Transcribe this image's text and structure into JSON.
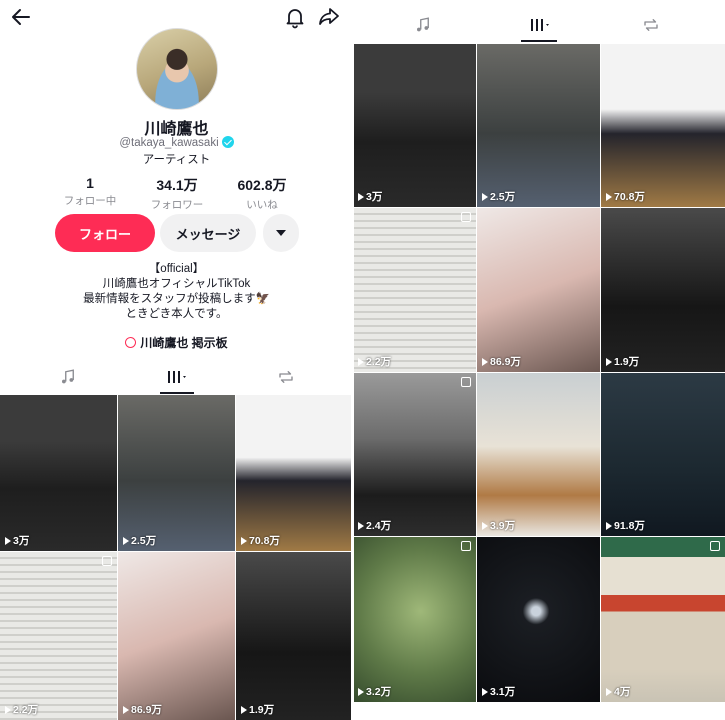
{
  "profile": {
    "name": "川崎鷹也",
    "handle": "@takaya_kawasaki",
    "category": "アーティスト",
    "stats": [
      {
        "value": "1",
        "label": "フォロー中"
      },
      {
        "value": "34.1万",
        "label": "フォロワー"
      },
      {
        "value": "602.8万",
        "label": "いいね"
      }
    ],
    "follow_label": "フォロー",
    "message_label": "メッセージ",
    "bio": [
      "【official】",
      "川崎鷹也オフィシャルTikTok",
      "最新情報をスタッフが投稿します🦅",
      "ときどき本人です。"
    ],
    "link_label": "川崎鷹也 掲示板"
  },
  "left_grid": [
    {
      "views": "3万"
    },
    {
      "views": "2.5万"
    },
    {
      "views": "70.8万"
    },
    {
      "views": "2.2万"
    },
    {
      "views": "86.9万"
    },
    {
      "views": "1.9万"
    }
  ],
  "right_grid": [
    {
      "views": "3万"
    },
    {
      "views": "2.5万"
    },
    {
      "views": "70.8万"
    },
    {
      "views": "2.2万"
    },
    {
      "views": "86.9万"
    },
    {
      "views": "1.9万"
    },
    {
      "views": "2.4万"
    },
    {
      "views": "3.9万"
    },
    {
      "views": "91.8万"
    },
    {
      "views": "3.2万"
    },
    {
      "views": "3.1万"
    },
    {
      "views": "4万"
    }
  ],
  "icons": [
    "back-arrow-icon",
    "bell-icon",
    "share-icon",
    "music-note-icon",
    "grid-icon",
    "repost-icon",
    "play-icon"
  ],
  "colors": {
    "accent": "#fe2c55",
    "verified": "#20d5ec",
    "text": "#161823"
  }
}
